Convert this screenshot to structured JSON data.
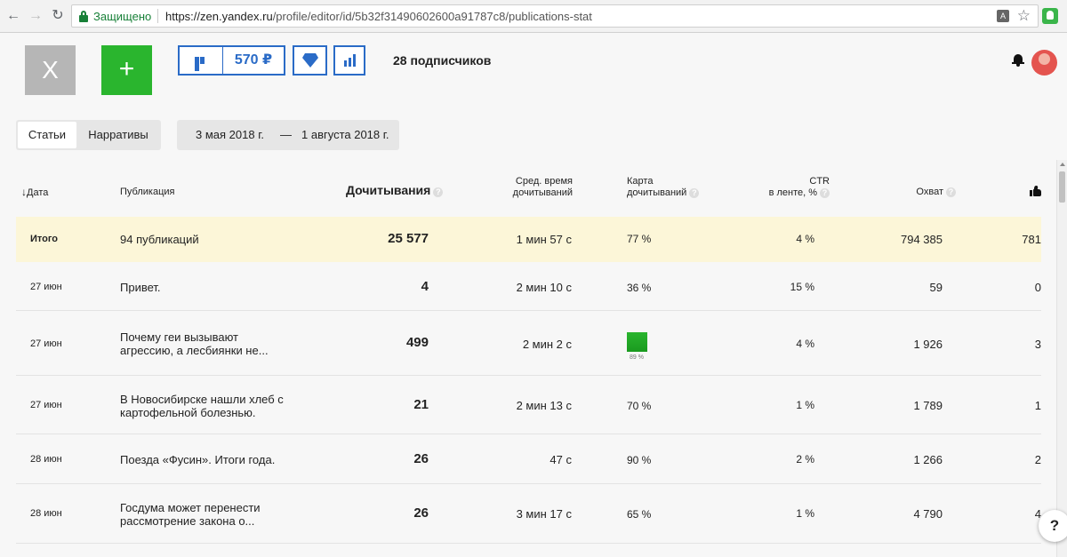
{
  "browser": {
    "secure_label": "Защищено",
    "url_host": "https://zen.yandex.ru",
    "url_path": "/profile/editor/id/5b32f31490602600a91787c8/publications-stat"
  },
  "header": {
    "avatar_letter": "X",
    "add_label": "+",
    "balance": "570 ₽",
    "subscribers": "28 подписчиков"
  },
  "tabs": {
    "articles": "Статьи",
    "narratives": "Нарративы"
  },
  "date_range": {
    "from": "3 мая 2018 г.",
    "dash": "—",
    "to": "1 августа 2018 г."
  },
  "table": {
    "headers": {
      "date": "Дата",
      "publication": "Публикация",
      "reads": "Дочитывания",
      "avg_time_1": "Сред. время",
      "avg_time_2": "дочитываний",
      "map_1": "Карта",
      "map_2": "дочитываний",
      "ctr_1": "CTR",
      "ctr_2": "в ленте, %",
      "reach": "Охват",
      "help": "?"
    },
    "total": {
      "label": "Итого",
      "title": "94 публикаций",
      "reads": "25 577",
      "avg": "1 мин 57 с",
      "map": "77 %",
      "ctr": "4 %",
      "reach": "794 385",
      "likes": "781"
    },
    "rows": [
      {
        "date": "27 июн",
        "title": "Привет.",
        "reads": "4",
        "avg": "2 мин 10 с",
        "map": "36 %",
        "ctr": "15 %",
        "reach": "59",
        "likes": "0"
      },
      {
        "date": "27 июн",
        "title": "Почему геи вызывают агрессию, а лесбиянки не...",
        "reads": "499",
        "avg": "2 мин 2 с",
        "map": "89 %",
        "ctr": "4 %",
        "reach": "1 926",
        "likes": "3"
      },
      {
        "date": "27 июн",
        "title": "В Новосибирске нашли хлеб с картофельной болезнью.",
        "reads": "21",
        "avg": "2 мин 13 с",
        "map": "70 %",
        "ctr": "1 %",
        "reach": "1 789",
        "likes": "1"
      },
      {
        "date": "28 июн",
        "title": "Поезда «Фусин». Итоги года.",
        "reads": "26",
        "avg": "47 с",
        "map": "90 %",
        "ctr": "2 %",
        "reach": "1 266",
        "likes": "2"
      },
      {
        "date": "28 июн",
        "title": "Госдума может перенести рассмотрение закона о...",
        "reads": "26",
        "avg": "3 мин 17 с",
        "map": "65 %",
        "ctr": "1 %",
        "reach": "4 790",
        "likes": "4"
      }
    ]
  },
  "help_button": "?",
  "colors": {
    "accent_blue": "#2a6bc7",
    "add_green": "#2ab52e",
    "total_row_bg": "#fcf6d8",
    "secure_green": "#188038"
  }
}
